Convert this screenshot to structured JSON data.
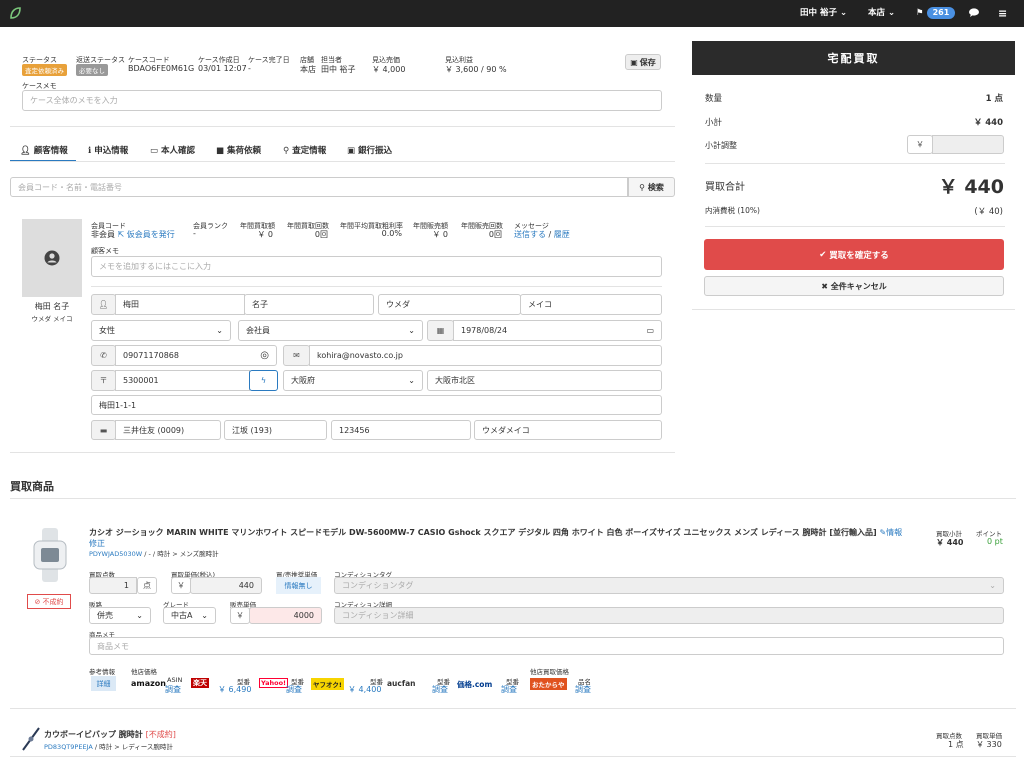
{
  "topbar": {
    "user": "田中 裕子",
    "store": "本店",
    "flag_count": "261"
  },
  "case": {
    "fields": [
      {
        "label": "ステータス",
        "tag": "査定依頼済み",
        "tag_color": "#e8a13a"
      },
      {
        "label": "返送ステータス",
        "tag": "必要なし",
        "tag_color": "#999999"
      },
      {
        "label": "ケースコード",
        "value": "BDAO6FE0M61G"
      },
      {
        "label": "ケース作成日",
        "value": "03/01 12:07"
      },
      {
        "label": "ケース完了日",
        "value": "-"
      },
      {
        "label": "店舗",
        "value": "本店"
      },
      {
        "label": "担当者",
        "value": "田中 裕子"
      },
      {
        "label": "見込売価",
        "value": "￥ 4,000"
      },
      {
        "label": "見込利益",
        "value": "￥ 3,600 / 90 %"
      }
    ],
    "save_label": "保存",
    "memo_label": "ケースメモ",
    "memo_placeholder": "ケース全体のメモを入力"
  },
  "tabs": [
    "顧客情報",
    "申込情報",
    "本人確認",
    "集荷依頼",
    "査定情報",
    "銀行振込"
  ],
  "search": {
    "placeholder": "会員コード・名前・電話番号",
    "button": "検索"
  },
  "customer": {
    "name": "梅田 名子",
    "kana": "ウメダ メイコ",
    "member_code_label": "会員コード",
    "member_code_value": "非会員",
    "temp_member_link": "仮会員を発行",
    "stats": [
      {
        "label": "会員ランク",
        "value": "-"
      },
      {
        "label": "年間買取額",
        "value": "￥ 0"
      },
      {
        "label": "年間買取回数",
        "value": "0回"
      },
      {
        "label": "年間平均買取粗利率",
        "value": "0.0%"
      },
      {
        "label": "年間販売額",
        "value": "￥ 0"
      },
      {
        "label": "年間販売回数",
        "value": "0回"
      }
    ],
    "message_label": "メッセージ",
    "message_send": "送信する",
    "message_sep": " / ",
    "message_history": "履歴",
    "memo_label": "顧客メモ",
    "memo_placeholder": "メモを追加するにはここに入力",
    "last_name": "梅田",
    "first_name": "名子",
    "last_kana": "ウメダ",
    "first_kana": "メイコ",
    "gender": "女性",
    "occupation": "会社員",
    "birthday": "1978/08/24",
    "phone": "09071170868",
    "email": "kohira@novasto.co.jp",
    "zip": "5300001",
    "prefecture": "大阪府",
    "city": "大阪市北区",
    "address": "梅田1-1-1",
    "bank": "三井住友 (0009)",
    "branch": "江坂 (193)",
    "account": "123456",
    "holder": "ウメダメイコ"
  },
  "products_heading": "買取商品",
  "product1": {
    "title": "カシオ ジーショック MARIN WHITE マリンホワイト スピードモデル DW-5600MW-7 CASIO Gshock スクエア デジタル 四角 ホワイト 白色 ボーイズサイズ ユニセックス メンズ レディース 腕時計 [並行輸入品]",
    "info_link": "情報",
    "edit_link": "修正",
    "code": "PDYWJAD5030W",
    "category": " / - / 時計 > メンズ腕時計",
    "status_badge": "不成約",
    "subtotal_label": "買取小計",
    "subtotal": "￥ 440",
    "point_label": "ポイント",
    "point": "0 pt",
    "qty_label": "買取点数",
    "qty": "1",
    "qty_unit": "点",
    "unit_price_label": "買取単価(税込)",
    "unit_price": "440",
    "yen": "￥",
    "recommend_label": "買/売推奨単価",
    "recommend_value": "情報無し",
    "cond_tag_label": "コンディションタグ",
    "cond_tag_placeholder": "コンディションタグ",
    "channel_label": "販路",
    "channel": "併売",
    "grade_label": "グレード",
    "grade": "中古A",
    "sale_price_label": "販売単価",
    "sale_price": "4000",
    "cond_detail_label": "コンディション詳細",
    "cond_detail_placeholder": "コンディション詳細",
    "memo_label": "商品メモ",
    "memo_placeholder": "商品メモ",
    "ref_label": "参考情報",
    "ref_button": "詳細",
    "other_price_label": "他店価格",
    "other_buy_label": "他店買取価格",
    "markets": [
      {
        "logo": "amazon",
        "sub": "ASIN",
        "val": "調査"
      },
      {
        "logo": "楽天",
        "sub": "型番",
        "val": "￥ 6,490"
      },
      {
        "logo": "Yahoo!",
        "sub": "型番",
        "val": "調査"
      },
      {
        "logo": "ヤフオク!",
        "sub": "型番",
        "val": "￥ 4,400"
      },
      {
        "logo": "aucfan",
        "sub": "型番",
        "val": "調査"
      },
      {
        "logo": "価格.com",
        "sub": "型番",
        "val": "調査"
      },
      {
        "logo": "おたからや",
        "sub": "品名",
        "val": "調査"
      }
    ]
  },
  "product2": {
    "title": "カウボーイビバップ 腕時計",
    "status": "[不成約]",
    "code": "PD83QT9PEEJA",
    "category": " / 時計 > レディース腕時計",
    "qty_label": "買取点数",
    "qty": "1 点",
    "price_label": "買取単価",
    "price": "￥ 330"
  },
  "panel": {
    "title": "宅配買取",
    "qty_label": "数量",
    "qty": "1 点",
    "subtotal_label": "小計",
    "subtotal": "￥ 440",
    "adjust_label": "小計調整",
    "yen": "￥",
    "total_label": "買取合計",
    "total": "￥ 440",
    "tax_label": "内消費税 (10%)",
    "tax": "(￥ 40)",
    "confirm": "買取を確定する",
    "cancel": "全件キャンセル"
  },
  "colors": {
    "danger": "#e04b4a",
    "dark": "#222222",
    "link": "#2a7ac0"
  }
}
